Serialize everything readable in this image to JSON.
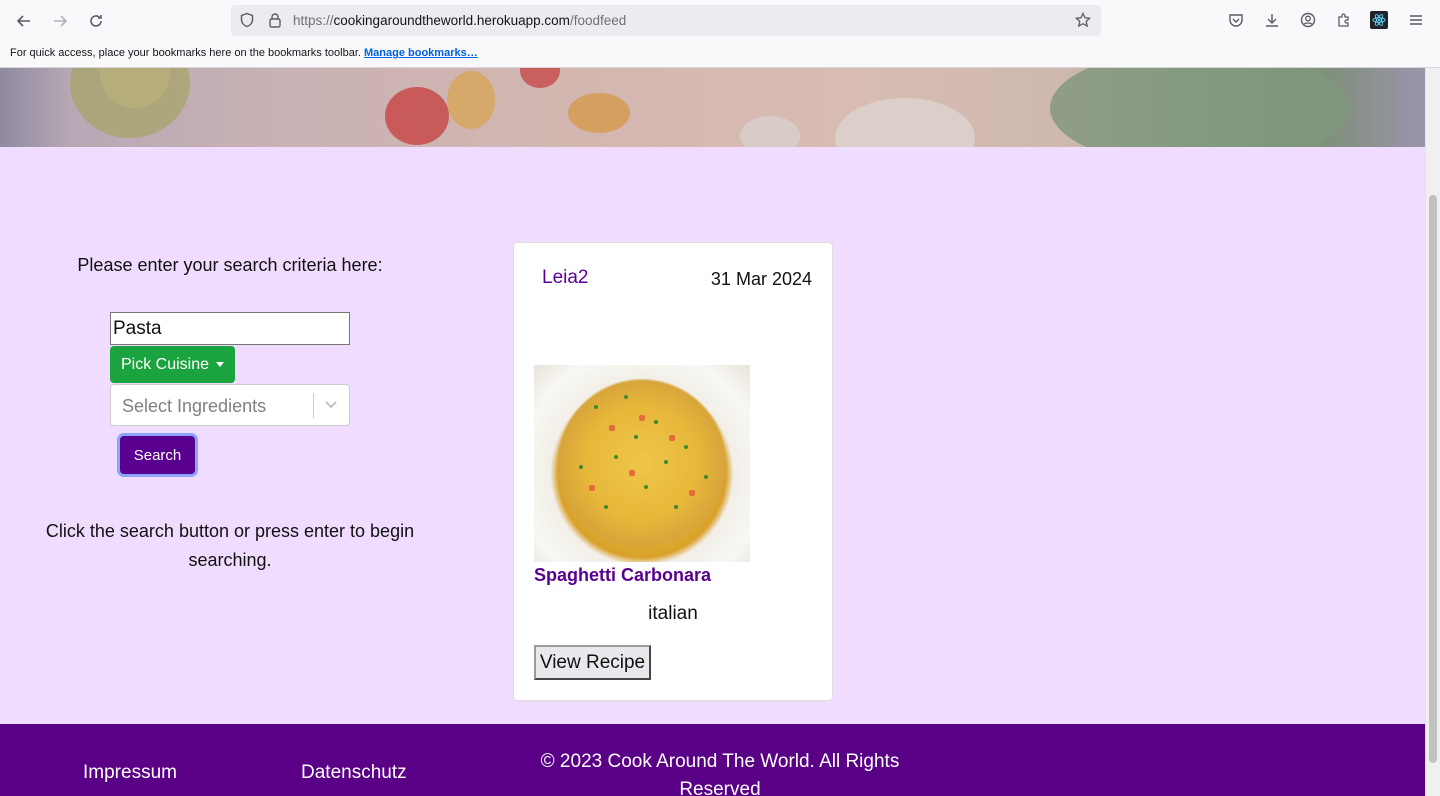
{
  "browser": {
    "url_prefix": "https://",
    "url_host": "cookingaroundtheworld.herokuapp.com",
    "url_path": "/foodfeed",
    "bookmarks_message": "For quick access, place your bookmarks here on the bookmarks toolbar.",
    "bookmarks_link": "Manage bookmarks…"
  },
  "search": {
    "prompt": "Please enter your search criteria here:",
    "query": "Pasta",
    "cuisine_button": "Pick Cuisine",
    "ingredients_placeholder": "Select Ingredients",
    "search_button": "Search",
    "hint": "Click the search button or press enter to begin searching."
  },
  "recipe_card": {
    "user": "Leia2",
    "date": "31 Mar 2024",
    "title": "Spaghetti Carbonara",
    "cuisine": "italian",
    "view_button": "View Recipe"
  },
  "footer": {
    "impressum": "Impressum",
    "datenschutz": "Datenschutz",
    "copyright": "© 2023 Cook Around The World. All Rights Reserved"
  },
  "colors": {
    "page_background": "#efdcff",
    "brand_purple": "#5a0090",
    "cuisine_green": "#1aa33f",
    "footer_purple": "#5a0087"
  }
}
